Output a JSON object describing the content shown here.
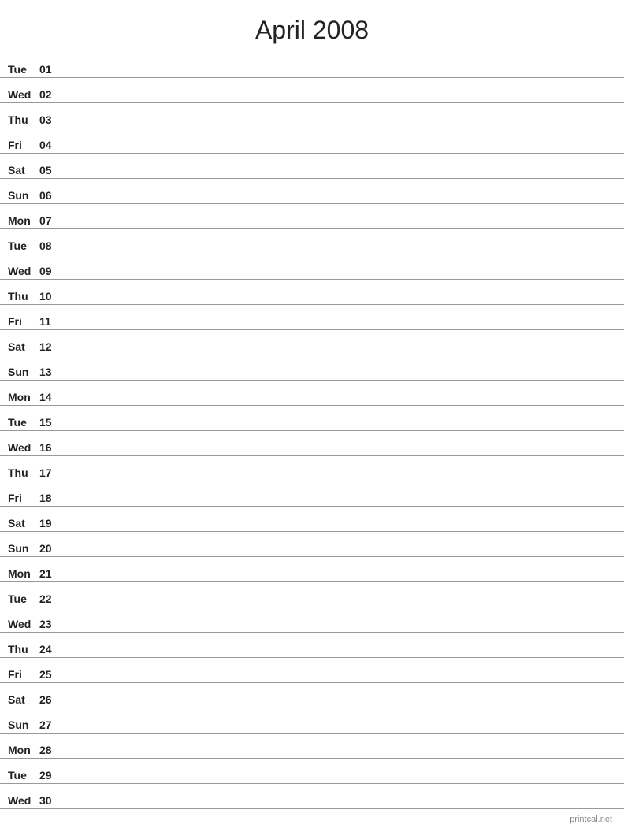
{
  "title": "April 2008",
  "footer": "printcal.net",
  "days": [
    {
      "name": "Tue",
      "num": "01"
    },
    {
      "name": "Wed",
      "num": "02"
    },
    {
      "name": "Thu",
      "num": "03"
    },
    {
      "name": "Fri",
      "num": "04"
    },
    {
      "name": "Sat",
      "num": "05"
    },
    {
      "name": "Sun",
      "num": "06"
    },
    {
      "name": "Mon",
      "num": "07"
    },
    {
      "name": "Tue",
      "num": "08"
    },
    {
      "name": "Wed",
      "num": "09"
    },
    {
      "name": "Thu",
      "num": "10"
    },
    {
      "name": "Fri",
      "num": "11"
    },
    {
      "name": "Sat",
      "num": "12"
    },
    {
      "name": "Sun",
      "num": "13"
    },
    {
      "name": "Mon",
      "num": "14"
    },
    {
      "name": "Tue",
      "num": "15"
    },
    {
      "name": "Wed",
      "num": "16"
    },
    {
      "name": "Thu",
      "num": "17"
    },
    {
      "name": "Fri",
      "num": "18"
    },
    {
      "name": "Sat",
      "num": "19"
    },
    {
      "name": "Sun",
      "num": "20"
    },
    {
      "name": "Mon",
      "num": "21"
    },
    {
      "name": "Tue",
      "num": "22"
    },
    {
      "name": "Wed",
      "num": "23"
    },
    {
      "name": "Thu",
      "num": "24"
    },
    {
      "name": "Fri",
      "num": "25"
    },
    {
      "name": "Sat",
      "num": "26"
    },
    {
      "name": "Sun",
      "num": "27"
    },
    {
      "name": "Mon",
      "num": "28"
    },
    {
      "name": "Tue",
      "num": "29"
    },
    {
      "name": "Wed",
      "num": "30"
    }
  ]
}
